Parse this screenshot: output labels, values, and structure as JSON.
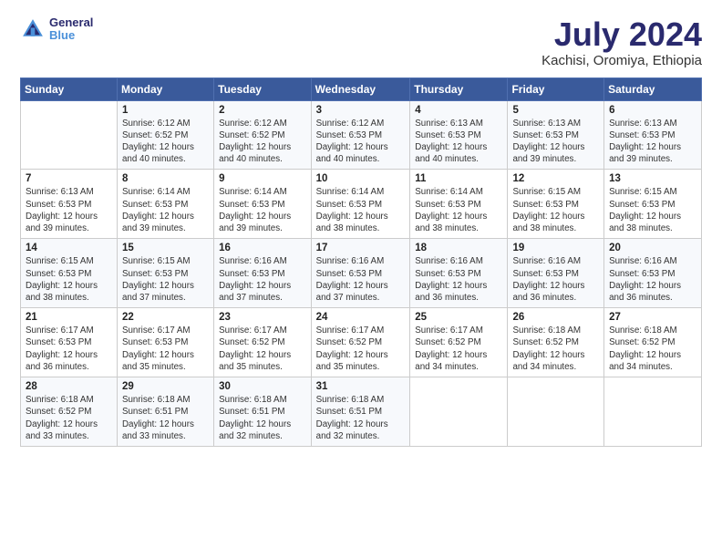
{
  "logo": {
    "text1": "General",
    "text2": "Blue"
  },
  "header": {
    "title": "July 2024",
    "subtitle": "Kachisi, Oromiya, Ethiopia"
  },
  "weekdays": [
    "Sunday",
    "Monday",
    "Tuesday",
    "Wednesday",
    "Thursday",
    "Friday",
    "Saturday"
  ],
  "weeks": [
    [
      {
        "day": "",
        "info": ""
      },
      {
        "day": "1",
        "info": "Sunrise: 6:12 AM\nSunset: 6:52 PM\nDaylight: 12 hours\nand 40 minutes."
      },
      {
        "day": "2",
        "info": "Sunrise: 6:12 AM\nSunset: 6:52 PM\nDaylight: 12 hours\nand 40 minutes."
      },
      {
        "day": "3",
        "info": "Sunrise: 6:12 AM\nSunset: 6:53 PM\nDaylight: 12 hours\nand 40 minutes."
      },
      {
        "day": "4",
        "info": "Sunrise: 6:13 AM\nSunset: 6:53 PM\nDaylight: 12 hours\nand 40 minutes."
      },
      {
        "day": "5",
        "info": "Sunrise: 6:13 AM\nSunset: 6:53 PM\nDaylight: 12 hours\nand 39 minutes."
      },
      {
        "day": "6",
        "info": "Sunrise: 6:13 AM\nSunset: 6:53 PM\nDaylight: 12 hours\nand 39 minutes."
      }
    ],
    [
      {
        "day": "7",
        "info": "Sunrise: 6:13 AM\nSunset: 6:53 PM\nDaylight: 12 hours\nand 39 minutes."
      },
      {
        "day": "8",
        "info": "Sunrise: 6:14 AM\nSunset: 6:53 PM\nDaylight: 12 hours\nand 39 minutes."
      },
      {
        "day": "9",
        "info": "Sunrise: 6:14 AM\nSunset: 6:53 PM\nDaylight: 12 hours\nand 39 minutes."
      },
      {
        "day": "10",
        "info": "Sunrise: 6:14 AM\nSunset: 6:53 PM\nDaylight: 12 hours\nand 38 minutes."
      },
      {
        "day": "11",
        "info": "Sunrise: 6:14 AM\nSunset: 6:53 PM\nDaylight: 12 hours\nand 38 minutes."
      },
      {
        "day": "12",
        "info": "Sunrise: 6:15 AM\nSunset: 6:53 PM\nDaylight: 12 hours\nand 38 minutes."
      },
      {
        "day": "13",
        "info": "Sunrise: 6:15 AM\nSunset: 6:53 PM\nDaylight: 12 hours\nand 38 minutes."
      }
    ],
    [
      {
        "day": "14",
        "info": "Sunrise: 6:15 AM\nSunset: 6:53 PM\nDaylight: 12 hours\nand 38 minutes."
      },
      {
        "day": "15",
        "info": "Sunrise: 6:15 AM\nSunset: 6:53 PM\nDaylight: 12 hours\nand 37 minutes."
      },
      {
        "day": "16",
        "info": "Sunrise: 6:16 AM\nSunset: 6:53 PM\nDaylight: 12 hours\nand 37 minutes."
      },
      {
        "day": "17",
        "info": "Sunrise: 6:16 AM\nSunset: 6:53 PM\nDaylight: 12 hours\nand 37 minutes."
      },
      {
        "day": "18",
        "info": "Sunrise: 6:16 AM\nSunset: 6:53 PM\nDaylight: 12 hours\nand 36 minutes."
      },
      {
        "day": "19",
        "info": "Sunrise: 6:16 AM\nSunset: 6:53 PM\nDaylight: 12 hours\nand 36 minutes."
      },
      {
        "day": "20",
        "info": "Sunrise: 6:16 AM\nSunset: 6:53 PM\nDaylight: 12 hours\nand 36 minutes."
      }
    ],
    [
      {
        "day": "21",
        "info": "Sunrise: 6:17 AM\nSunset: 6:53 PM\nDaylight: 12 hours\nand 36 minutes."
      },
      {
        "day": "22",
        "info": "Sunrise: 6:17 AM\nSunset: 6:53 PM\nDaylight: 12 hours\nand 35 minutes."
      },
      {
        "day": "23",
        "info": "Sunrise: 6:17 AM\nSunset: 6:52 PM\nDaylight: 12 hours\nand 35 minutes."
      },
      {
        "day": "24",
        "info": "Sunrise: 6:17 AM\nSunset: 6:52 PM\nDaylight: 12 hours\nand 35 minutes."
      },
      {
        "day": "25",
        "info": "Sunrise: 6:17 AM\nSunset: 6:52 PM\nDaylight: 12 hours\nand 34 minutes."
      },
      {
        "day": "26",
        "info": "Sunrise: 6:18 AM\nSunset: 6:52 PM\nDaylight: 12 hours\nand 34 minutes."
      },
      {
        "day": "27",
        "info": "Sunrise: 6:18 AM\nSunset: 6:52 PM\nDaylight: 12 hours\nand 34 minutes."
      }
    ],
    [
      {
        "day": "28",
        "info": "Sunrise: 6:18 AM\nSunset: 6:52 PM\nDaylight: 12 hours\nand 33 minutes."
      },
      {
        "day": "29",
        "info": "Sunrise: 6:18 AM\nSunset: 6:51 PM\nDaylight: 12 hours\nand 33 minutes."
      },
      {
        "day": "30",
        "info": "Sunrise: 6:18 AM\nSunset: 6:51 PM\nDaylight: 12 hours\nand 32 minutes."
      },
      {
        "day": "31",
        "info": "Sunrise: 6:18 AM\nSunset: 6:51 PM\nDaylight: 12 hours\nand 32 minutes."
      },
      {
        "day": "",
        "info": ""
      },
      {
        "day": "",
        "info": ""
      },
      {
        "day": "",
        "info": ""
      }
    ]
  ]
}
